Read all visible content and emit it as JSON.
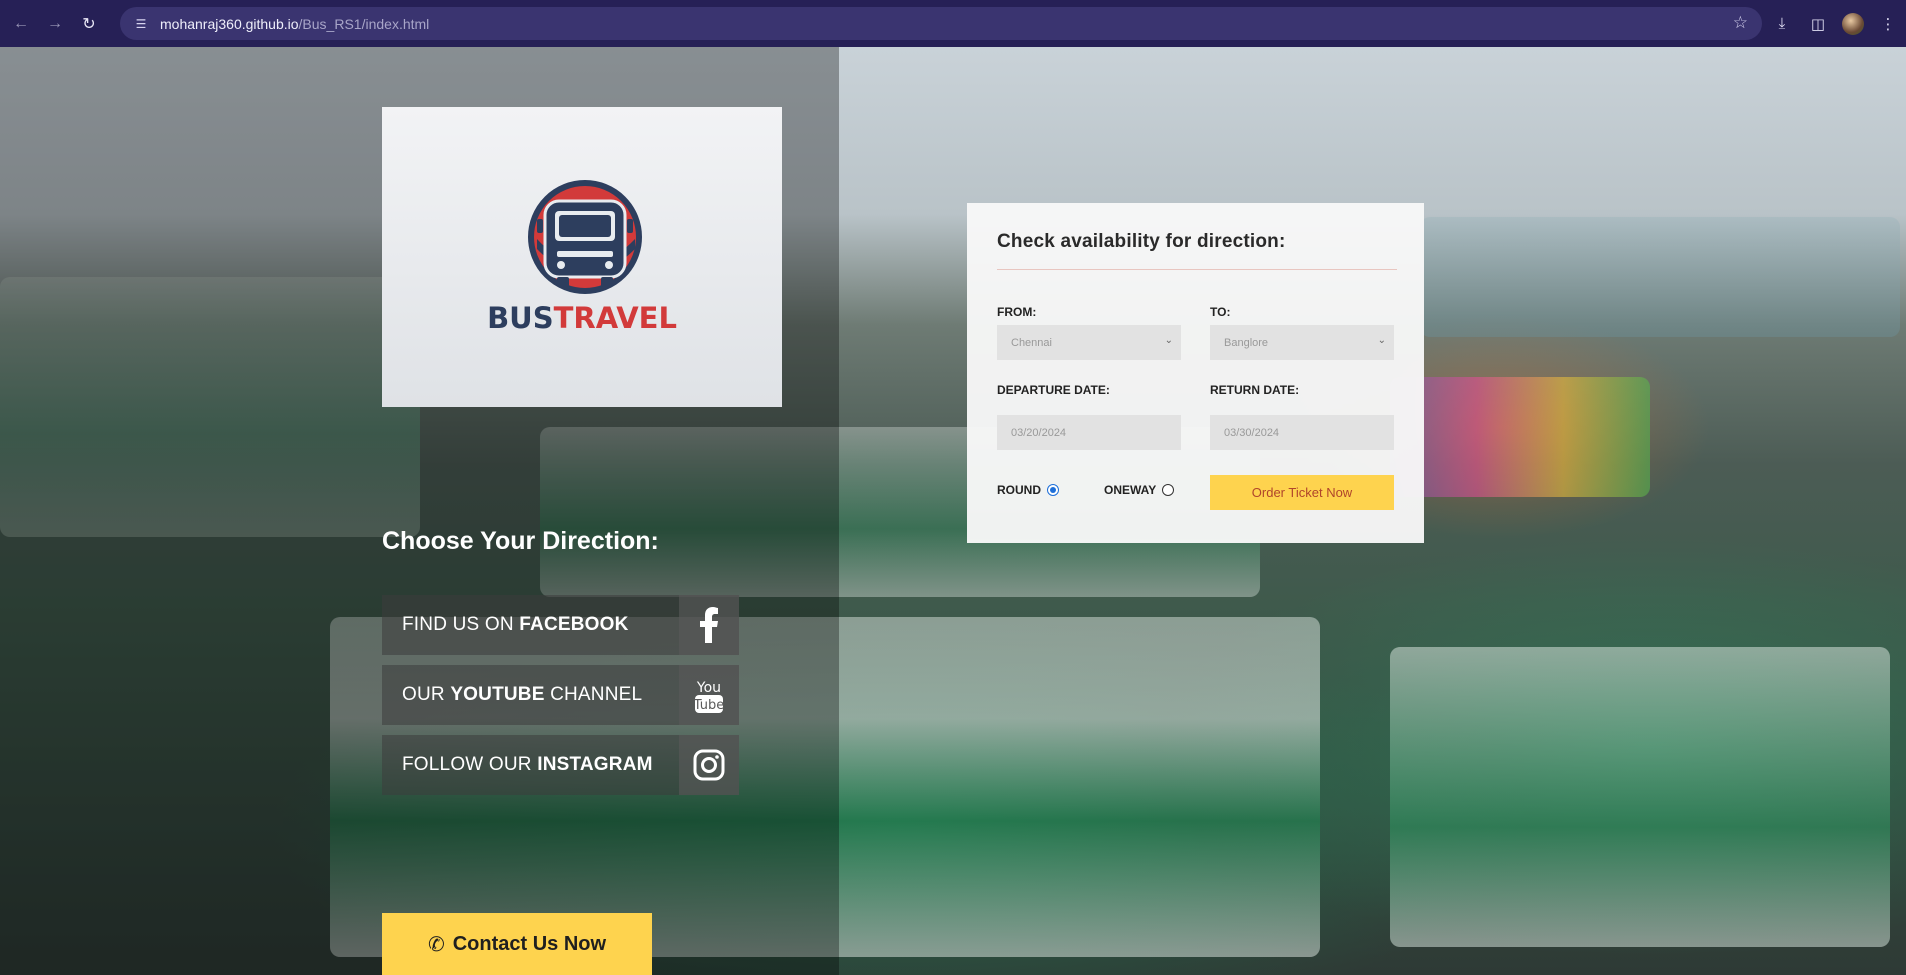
{
  "browser": {
    "url_host": "mohanraj360.github.io",
    "url_path": "/Bus_RS1/index.html"
  },
  "logo": {
    "part1": "BUS",
    "part2": "TRAVEL"
  },
  "left": {
    "title": "Choose Your Direction:",
    "social": [
      {
        "pre": "FIND US ON ",
        "bold": "FACEBOOK",
        "post": "",
        "icon": "facebook-icon"
      },
      {
        "pre": "OUR ",
        "bold": "YOUTUBE",
        "post": " CHANNEL",
        "icon": "youtube-icon"
      },
      {
        "pre": "FOLLOW OUR ",
        "bold": "INSTAGRAM",
        "post": "",
        "icon": "instagram-icon"
      }
    ],
    "contact_label": "Contact Us Now"
  },
  "form": {
    "title": "Check availability for direction:",
    "from_label": "FROM:",
    "from_value": "Chennai",
    "to_label": "TO:",
    "to_value": "Banglore",
    "departure_label": "DEPARTURE DATE:",
    "departure_value": "03/20/2024",
    "return_label": "RETURN DATE:",
    "return_value": "03/30/2024",
    "round_label": "ROUND",
    "oneway_label": "ONEWAY",
    "order_label": "Order Ticket Now"
  },
  "colors": {
    "accent_yellow": "#fed34e",
    "brand_navy": "#2d3e5e",
    "brand_red": "#d23a3a"
  }
}
